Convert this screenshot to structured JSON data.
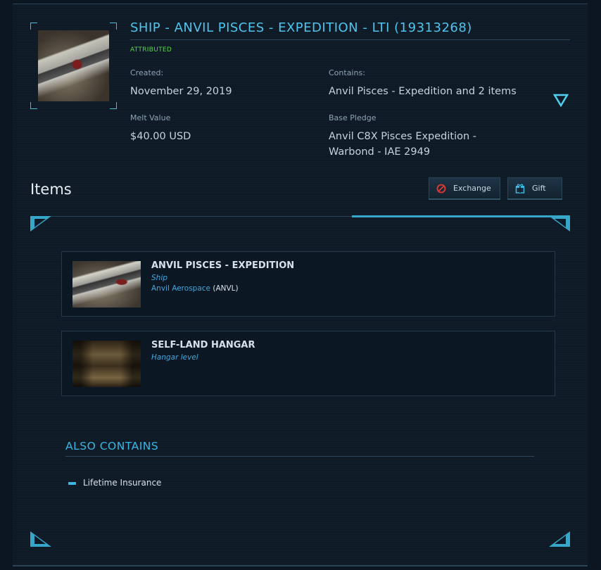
{
  "pledge": {
    "title": "SHIP - ANVIL PISCES - EXPEDITION - LTI (19313268)",
    "status": "ATTRIBUTED",
    "created_label": "Created:",
    "created_value": "November 29, 2019",
    "contains_label": "Contains:",
    "contains_value": "Anvil Pisces - Expedition and 2 items",
    "melt_label": "Melt Value",
    "melt_value": "$40.00 USD",
    "base_label": "Base Pledge",
    "base_value_line1": "Anvil C8X Pisces Expedition -",
    "base_value_line2": "Warbond - IAE 2949",
    "expand_icon": "chevron-down-triangle-icon"
  },
  "items_section": {
    "heading": "Items",
    "exchange_label": "Exchange",
    "gift_label": "Gift",
    "exchange_icon": "no-symbol-icon",
    "gift_icon": "gift-box-icon",
    "accent_color": "#37a7c9",
    "list": [
      {
        "name": "ANVIL PISCES - EXPEDITION",
        "type": "Ship",
        "manufacturer": "Anvil Aerospace",
        "manufacturer_code": "(ANVL)"
      },
      {
        "name": "SELF-LAND HANGAR",
        "type": "Hangar level"
      }
    ]
  },
  "also_contains": {
    "heading": "ALSO CONTAINS",
    "items": [
      "Lifetime Insurance"
    ]
  }
}
